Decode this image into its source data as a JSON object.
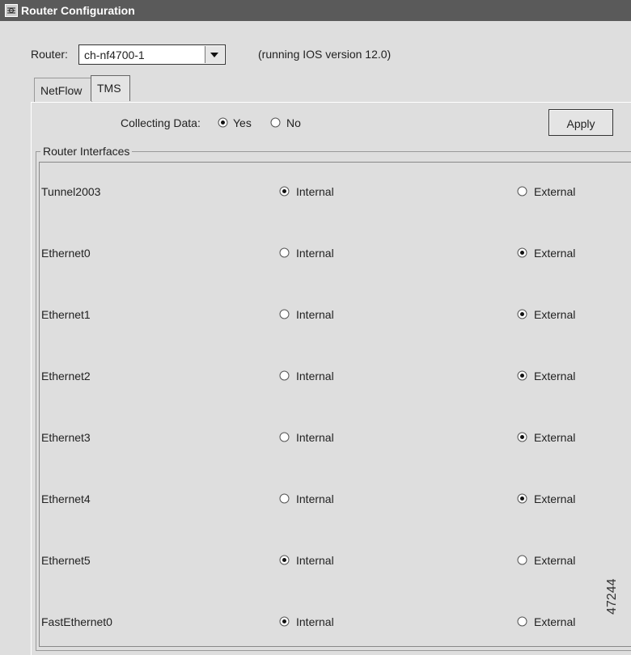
{
  "window": {
    "title": "Router Configuration"
  },
  "router": {
    "label": "Router:",
    "selected": "ch-nf4700-1",
    "ios_note": "(running IOS version 12.0)"
  },
  "tabs": [
    {
      "label": "NetFlow",
      "active": false
    },
    {
      "label": "TMS",
      "active": true
    }
  ],
  "collecting": {
    "label": "Collecting Data:",
    "yes_label": "Yes",
    "no_label": "No",
    "selected": "Yes"
  },
  "apply_label": "Apply",
  "interfaces_group": {
    "title": "Router Interfaces",
    "internal_label": "Internal",
    "external_label": "External",
    "rows": [
      {
        "name": "Tunnel2003",
        "selected": "Internal"
      },
      {
        "name": "Ethernet0",
        "selected": "External"
      },
      {
        "name": "Ethernet1",
        "selected": "External"
      },
      {
        "name": "Ethernet2",
        "selected": "External"
      },
      {
        "name": "Ethernet3",
        "selected": "External"
      },
      {
        "name": "Ethernet4",
        "selected": "External"
      },
      {
        "name": "Ethernet5",
        "selected": "Internal"
      },
      {
        "name": "FastEthernet0",
        "selected": "Internal"
      }
    ]
  },
  "side_number": "47244"
}
